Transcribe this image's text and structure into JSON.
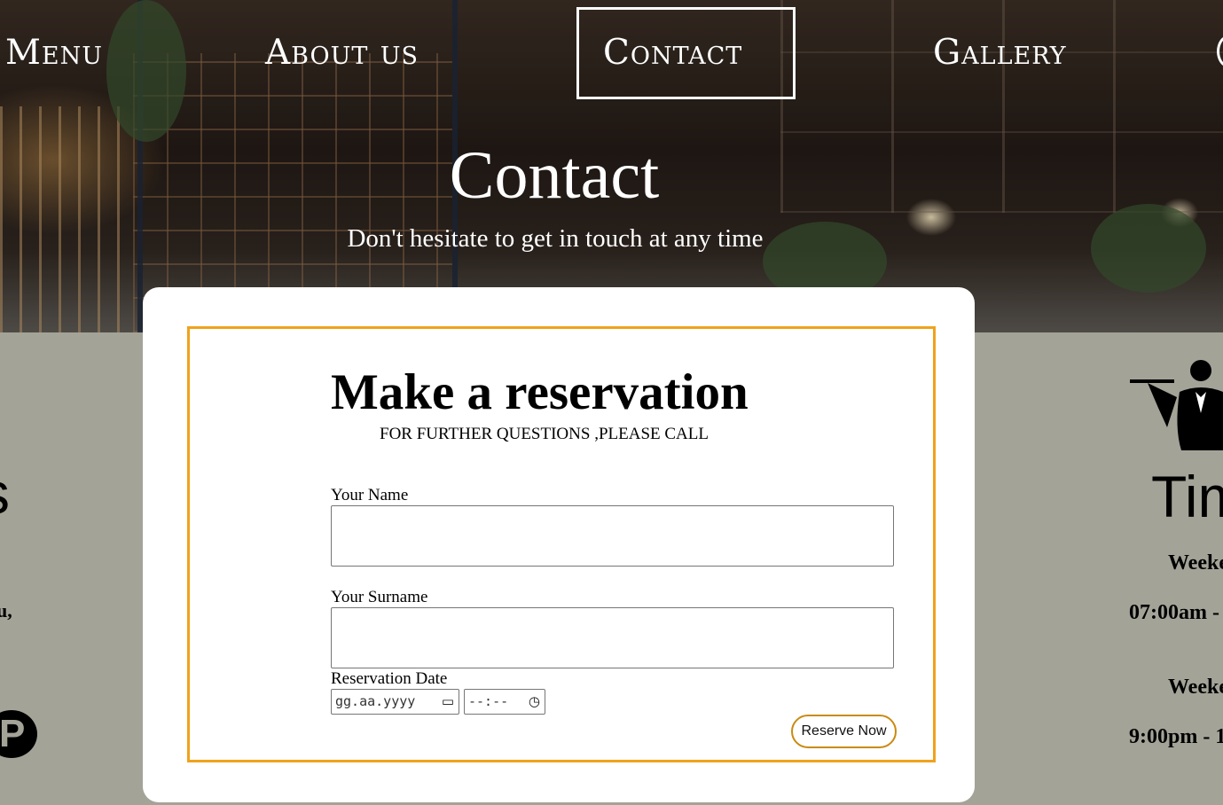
{
  "nav": {
    "items": [
      {
        "label": "Menu"
      },
      {
        "label": "About us"
      },
      {
        "label": "Contact"
      },
      {
        "label": "Gallery"
      }
    ],
    "active_index": 2
  },
  "hero": {
    "title": "Contact",
    "subtitle": "Don't hesitate to get in touch at any time"
  },
  "left_column": {
    "heading_fragment": "s",
    "text_fragment": "u,",
    "icon": "pinterest-icon"
  },
  "right_column": {
    "icon": "waiter-icon",
    "heading_fragment": "Tim",
    "line1": "Weeke",
    "line2": "07:00am -",
    "line3": "Weeke",
    "line4": "9:00pm - 1"
  },
  "reservation": {
    "title": "Make a reservation",
    "subtitle": "FOR FURTHER QUESTIONS ,PLEASE CALL",
    "name_label": "Your Name",
    "name_value": "",
    "surname_label": "Your Surname",
    "surname_value": "",
    "date_label": "Reservation Date",
    "date_placeholder": "gg.aa.yyyy",
    "time_placeholder": "--:--",
    "submit_label": "Reserve Now"
  },
  "colors": {
    "accent": "#f0a21c",
    "page_background": "#a4a398",
    "card_background": "#ffffff"
  }
}
